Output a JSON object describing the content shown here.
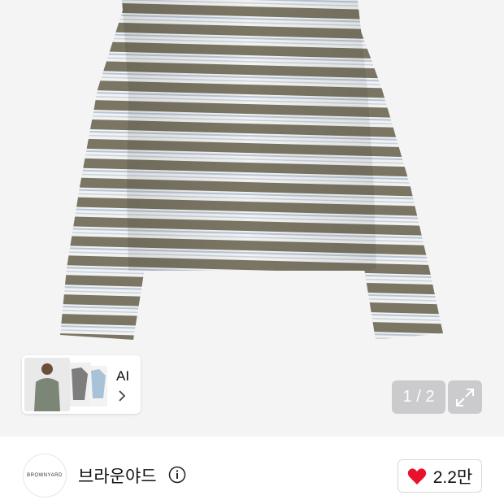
{
  "product_gallery": {
    "image_alt": "Striped long sleeve top",
    "page_indicator": "1 / 2",
    "ai_card": {
      "label": "AI"
    }
  },
  "brand": {
    "logo_text": "BROWNYARD",
    "name": "브라운야드"
  },
  "like": {
    "count": "2.2만"
  },
  "colors": {
    "stripe_olive": "#7b7664",
    "stripe_white": "#f1f2f4",
    "stripe_blue": "#b9c6d6",
    "heart": "#e8122d"
  }
}
